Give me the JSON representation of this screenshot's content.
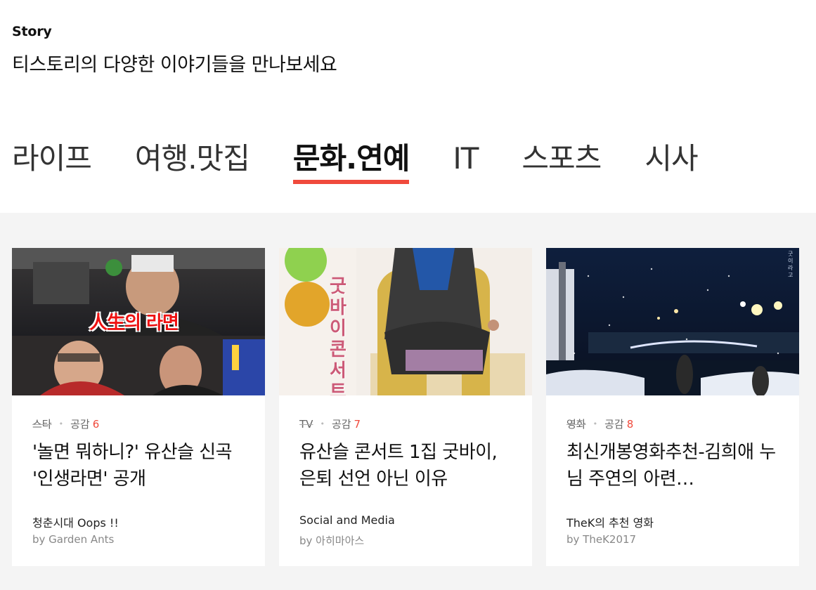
{
  "header": {
    "eyebrow": "Story",
    "headline": "티스토리의 다양한 이야기들을 만나보세요"
  },
  "tabs": [
    {
      "label": "라이프",
      "active": false
    },
    {
      "label": "여행.맛집",
      "active": false
    },
    {
      "label": "문화.연예",
      "active": true
    },
    {
      "label": "IT",
      "active": false
    },
    {
      "label": "스포츠",
      "active": false
    },
    {
      "label": "시사",
      "active": false
    }
  ],
  "cards": [
    {
      "category": "스타",
      "likes_label": "공감",
      "likes": "6",
      "title": "'놀면 뭐하니?' 유산슬 신곡 '인생라면' 공개",
      "blog": "청춘시대 Oops !!",
      "author": "by Garden Ants",
      "thumb_caption": "人生의 라면"
    },
    {
      "category": "TV",
      "likes_label": "공감",
      "likes": "7",
      "title": "유산슬 콘서트 1집 굿바이, 은퇴 선언 아닌 이유",
      "blog": "Social and Media",
      "author": "by 아히마아스",
      "thumb_caption": "굿바이 콘서트"
    },
    {
      "category": "영화",
      "likes_label": "공감",
      "likes": "8",
      "title": "최신개봉영화추천-김희애 누님 주연의 아련…",
      "blog": "TheK의 추천 영화",
      "author": "by TheK2017",
      "thumb_caption": "굿이라고"
    }
  ],
  "colors": {
    "accent": "#f04a3c",
    "background_gray": "#f4f4f4"
  }
}
